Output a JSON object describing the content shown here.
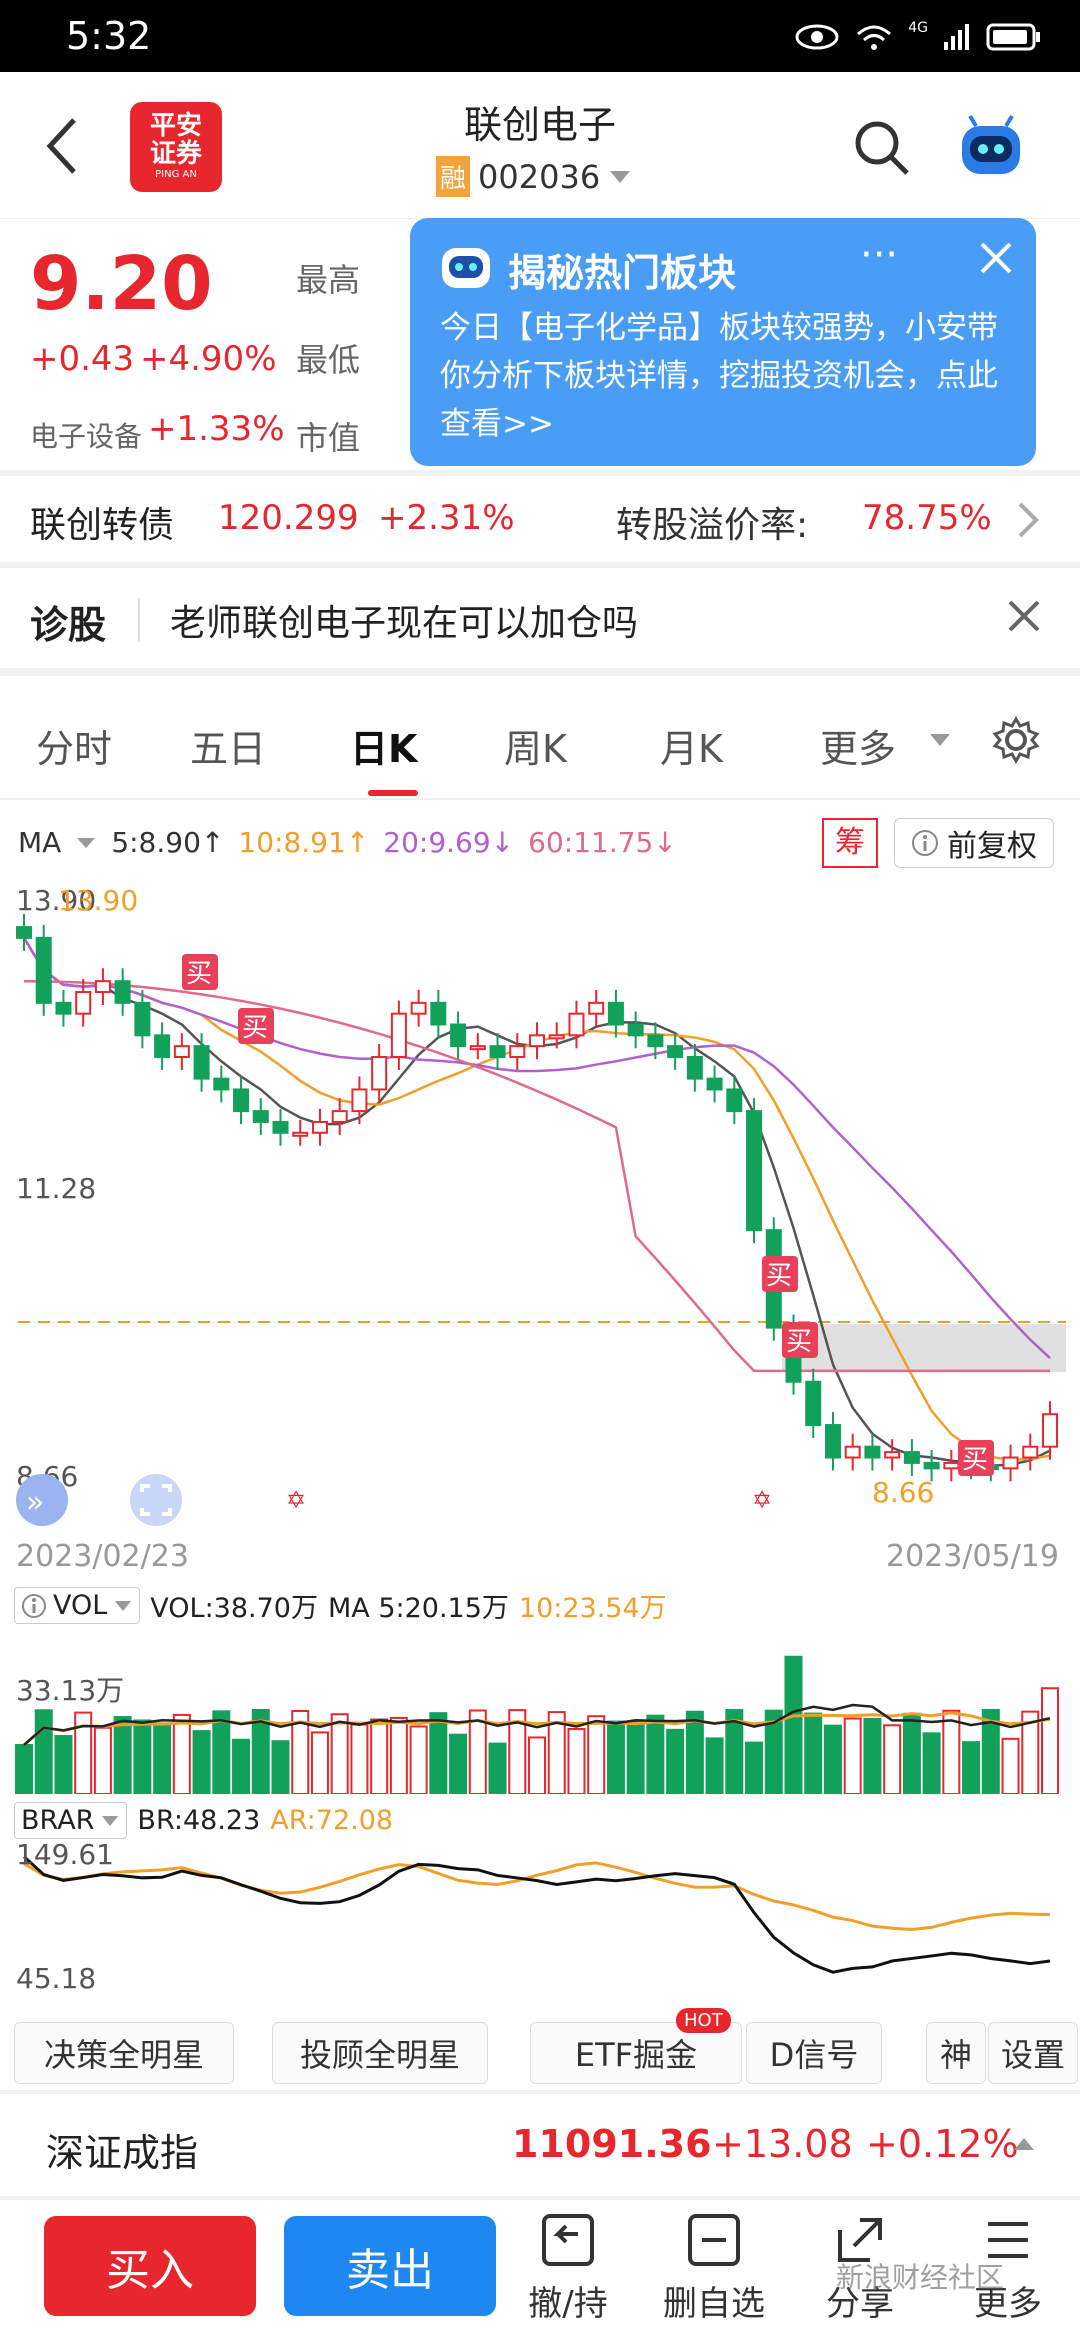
{
  "status": {
    "time": "5:32",
    "network": "4G"
  },
  "header": {
    "title": "联创电子",
    "margin_badge": "融",
    "code": "002036",
    "logo_line1": "平安",
    "logo_line2": "证券",
    "logo_sub": "PING AN"
  },
  "quote": {
    "price": "9.20",
    "change": "+0.43",
    "change_pct": "+4.90%",
    "sector": "电子设备",
    "sector_pct": "+1.33%",
    "high_label": "最高",
    "low_label": "最低",
    "mcap_label": "市值"
  },
  "popup": {
    "title": "揭秘热门板块",
    "body": "今日【电子化学品】板块较强势，小安带你分析下板块详情，挖掘投资机会，点此查看>>"
  },
  "bond": {
    "name": "联创转债",
    "price": "120.299",
    "pct": "+2.31%",
    "premium_label": "转股溢价率:",
    "premium": "78.75%"
  },
  "diag": {
    "label": "诊股",
    "question": "老师联创电子现在可以加仓吗"
  },
  "tabs": [
    "分时",
    "五日",
    "日K",
    "周K",
    "月K",
    "更多"
  ],
  "active_tab": "日K",
  "ma": {
    "label": "MA",
    "ma5": "5:8.90↑",
    "ma10": "10:8.91↑",
    "ma20": "20:9.69↓",
    "ma60": "60:11.75↓",
    "chip_btn": "筹",
    "adjust_btn": "前复权",
    "colors": {
      "ma5": "#333333",
      "ma10": "#f0a02a",
      "ma20": "#b060d0",
      "ma60": "#e06a8a"
    }
  },
  "chart": {
    "y_high": "13.90",
    "y_high2": "13.90",
    "y_mid": "11.28",
    "y_low": "8.66",
    "low_marker": "8.66",
    "date_start": "2023/02/23",
    "date_end": "2023/05/19",
    "buy": "买"
  },
  "vol": {
    "label": "VOL",
    "value": "VOL:38.70万",
    "ma5": "MA 5:20.15万",
    "ma10": "10:23.54万",
    "y_max": "33.13万"
  },
  "brar": {
    "label": "BRAR",
    "br": "BR:48.23",
    "ar": "AR:72.08",
    "y_top": "149.61",
    "y_bottom": "45.18"
  },
  "chips": {
    "c1": "决策全明星",
    "c2": "投顾全明星",
    "c3": "ETF掘金",
    "c3_hot": "HOT",
    "c4": "D信号",
    "c5": "神",
    "settings": "设置"
  },
  "index": {
    "name": "深证成指",
    "value": "11091.36",
    "change": "+13.08",
    "pct": "+0.12%"
  },
  "bottom": {
    "buy": "买入",
    "sell": "卖出",
    "t1": "撤/持",
    "t2": "删自选",
    "t3": "分享",
    "t4": "更多",
    "watermark": "新浪财经社区"
  }
}
